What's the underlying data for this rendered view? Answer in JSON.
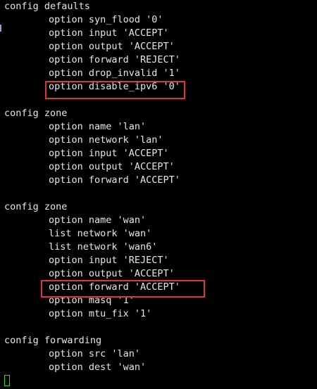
{
  "terminal": {
    "lines": [
      "config defaults",
      "option syn_flood '0'",
      "option input 'ACCEPT'",
      "option output 'ACCEPT'",
      "option forward 'REJECT'",
      "option drop_invalid '1'",
      "option disable_ipv6 '0'",
      "",
      "config zone",
      "option name 'lan'",
      "option network 'lan'",
      "option input 'ACCEPT'",
      "option output 'ACCEPT'",
      "option forward 'ACCEPT'",
      "",
      "config zone",
      "option name 'wan'",
      "list network 'wan'",
      "list network 'wan6'",
      "option input 'REJECT'",
      "option output 'ACCEPT'",
      "option forward 'ACCEPT'",
      "option masq '1'",
      "option mtu_fix '1'",
      "",
      "config forwarding",
      "option src 'lan'",
      "option dest 'wan'"
    ],
    "highlight_color": "#d9383a",
    "cursor_color": "#35d235"
  }
}
